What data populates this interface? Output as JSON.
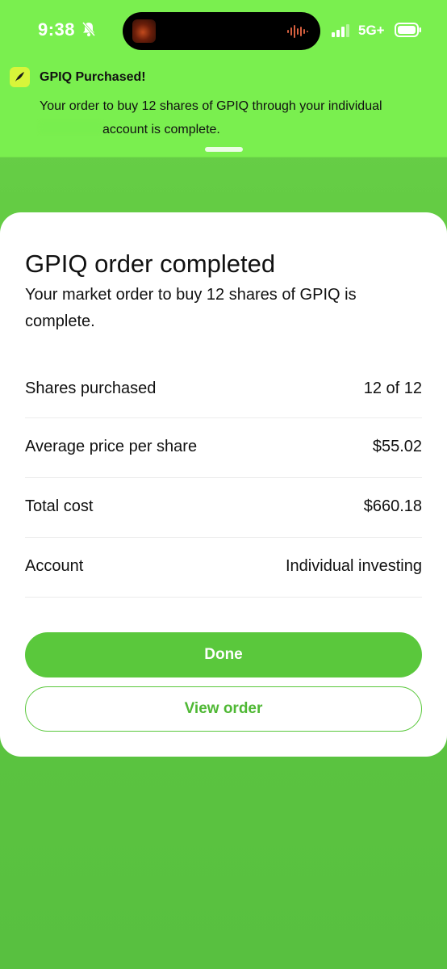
{
  "status_bar": {
    "time": "9:38",
    "network": "5G+",
    "icons": [
      "bell-slash-icon",
      "signal-icon",
      "battery-icon"
    ]
  },
  "notification": {
    "title": "GPIQ Purchased!",
    "body_line1": "Your order to buy 12 shares of GPIQ through your individual",
    "body_line2": "account is complete.",
    "app_icon": "feather-icon"
  },
  "card": {
    "title": "GPIQ order completed",
    "subtitle": "Your market order to buy 12 shares of GPIQ is complete.",
    "rows": [
      {
        "label": "Shares purchased",
        "value": "12 of 12"
      },
      {
        "label": "Average price per share",
        "value": "$55.02"
      },
      {
        "label": "Total cost",
        "value": "$660.18"
      },
      {
        "label": "Account",
        "value": "Individual investing"
      }
    ],
    "done_label": "Done",
    "view_order_label": "View order"
  },
  "colors": {
    "accent": "#5ac83c",
    "banner": "#7aef4f",
    "background": "#5fc83f"
  }
}
